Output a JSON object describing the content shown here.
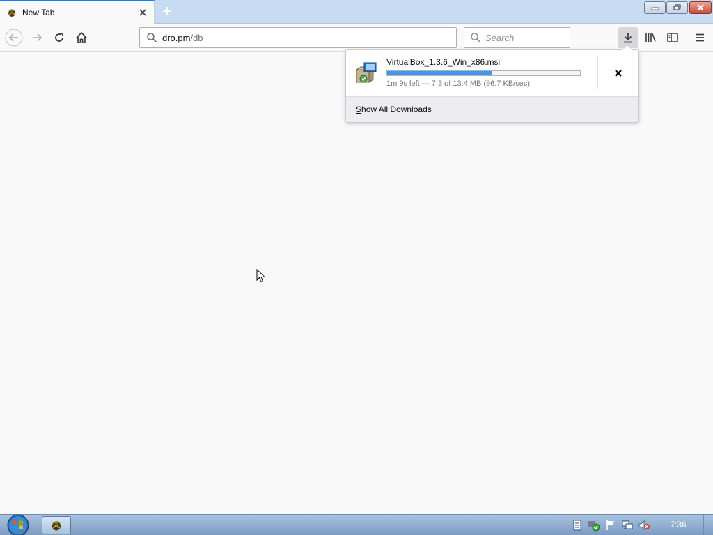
{
  "tab": {
    "title": "New Tab"
  },
  "urlbar": {
    "host": "dro.pm",
    "path": "/db"
  },
  "searchbar": {
    "placeholder": "Search"
  },
  "download": {
    "filename": "VirtualBox_1.3.6_Win_x86.msi",
    "status": "1m 9s left — 7.3 of 13.4 MB (96.7 KB/sec)",
    "progress_fraction": 0.545
  },
  "panel": {
    "show_all_accesskey": "S",
    "show_all_rest": "how All Downloads"
  },
  "taskbar": {
    "clock": "7:36"
  },
  "colors": {
    "accent": "#0a84ff",
    "progress": "#3d99ee"
  },
  "icons": [
    "firefox-favicon-icon",
    "close-icon",
    "plus-icon",
    "back-icon",
    "forward-icon",
    "reload-icon",
    "home-icon",
    "search-icon",
    "download-arrow-icon",
    "library-icon",
    "sidebar-icon",
    "hamburger-menu-icon",
    "installer-package-icon",
    "windows-start-icon"
  ]
}
